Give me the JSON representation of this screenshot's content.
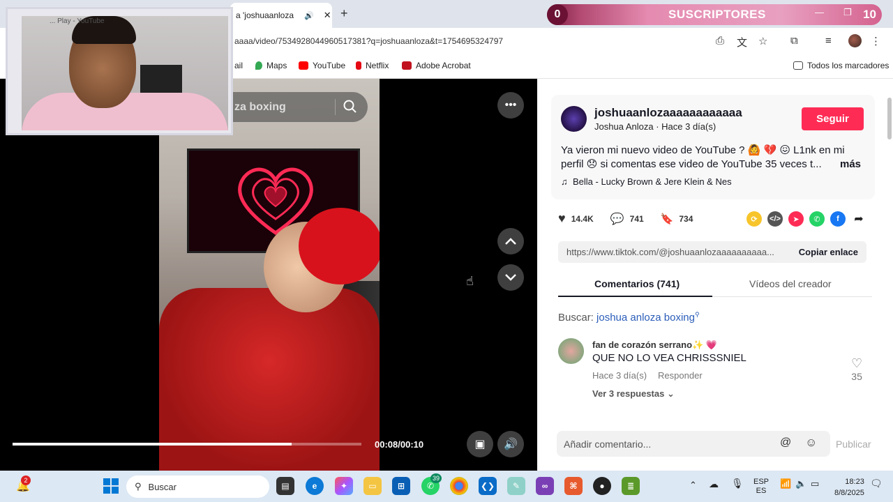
{
  "browser": {
    "tab_title": "a 'joshuaanloza",
    "webcam_tab_title": "... Play - YouTube",
    "url": "aaaa/video/7534928044960517381?q=joshuaanloza&t=1754695324797",
    "bookmarks": [
      {
        "label": "ail"
      },
      {
        "label": "Maps"
      },
      {
        "label": "YouTube"
      },
      {
        "label": "Netflix"
      },
      {
        "label": "Adobe Acrobat"
      }
    ],
    "all_bookmarks": "Todos los marcadores"
  },
  "subscriber_overlay": {
    "count_left": "0",
    "label": "SUSCRIPTORES",
    "count_right": "10"
  },
  "video": {
    "search_text": "za boxing",
    "time": "00:08/00:10",
    "progress_fraction": 0.8
  },
  "post": {
    "username": "joshuaanloza​aaaaaaaaaaa",
    "display_name": "Joshua Anloza",
    "time_ago": "Hace 3 día(s)",
    "follow_label": "Seguir",
    "description_line1": "Ya vieron mi nuevo video de YouTube ? 🙆 💔 😖 L1nk en mi",
    "description_line2": "perfil 😞 si comentas ese video de YouTube 35 veces t...",
    "more_label": "más",
    "music": "Bella - Lucky Brown & Jere Klein & Nes",
    "likes": "14.4K",
    "comments": "741",
    "saves": "734",
    "link": "https://www.tiktok.com/@joshuaanlozaaaaaaaaaa...",
    "copy_label": "Copiar enlace",
    "tab_comments": "Comentarios (741)",
    "tab_creator": "Vídeos del creador",
    "search_prefix": "Buscar:",
    "search_query": "joshua anloza boxing",
    "comment": {
      "author": "fan de corazón serrano✨ 💗",
      "text": "QUE NO LO VEA CHRISSSNIEL",
      "time": "Hace 3 día(s)",
      "reply": "Responder",
      "replies": "Ver 3 respuestas",
      "likes": "35"
    },
    "compose_placeholder": "Añadir comentario...",
    "publish_label": "Publicar"
  },
  "taskbar": {
    "search_label": "Buscar",
    "notif_badge": "2",
    "whatsapp_badge": "39",
    "lang_top": "ESP",
    "lang_bottom": "ES",
    "time": "18:23",
    "date": "8/8/2025"
  },
  "colors": {
    "follow": "#fe2c55",
    "link": "#2b5db9",
    "taskbar": "#dce8f4"
  }
}
